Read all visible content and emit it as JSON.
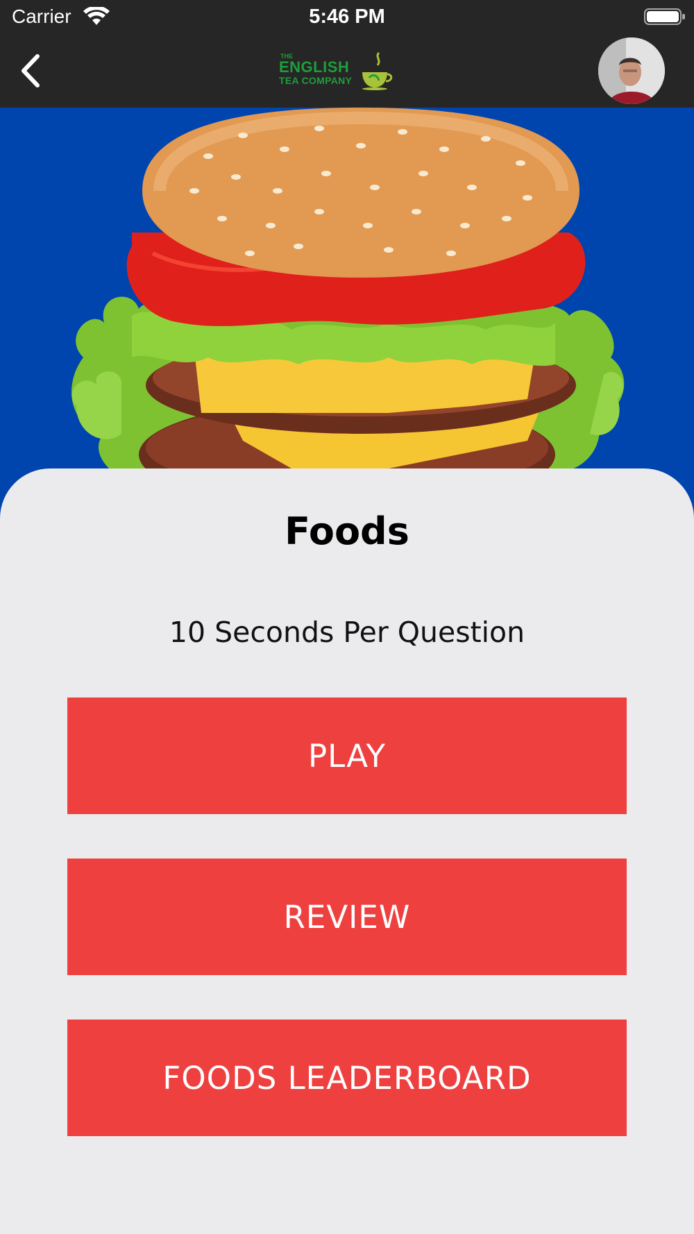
{
  "status_bar": {
    "carrier": "Carrier",
    "time": "5:46 PM"
  },
  "nav": {
    "back_icon": "chevron-left-icon",
    "logo": {
      "line_the": "THE",
      "line1": "ENGLISH",
      "line2": "TEA COMPANY"
    },
    "avatar": "user-avatar"
  },
  "hero": {
    "image": "hamburger-photo",
    "background_color": "#0044ae"
  },
  "quiz": {
    "title": "Foods",
    "subtitle": "10 Seconds Per Question"
  },
  "buttons": {
    "play": "PLAY",
    "review": "REVIEW",
    "leaderboard": "FOODS LEADERBOARD"
  },
  "colors": {
    "accent": "#ef4040",
    "header": "#262626",
    "brand_green": "#1e9e3a"
  }
}
